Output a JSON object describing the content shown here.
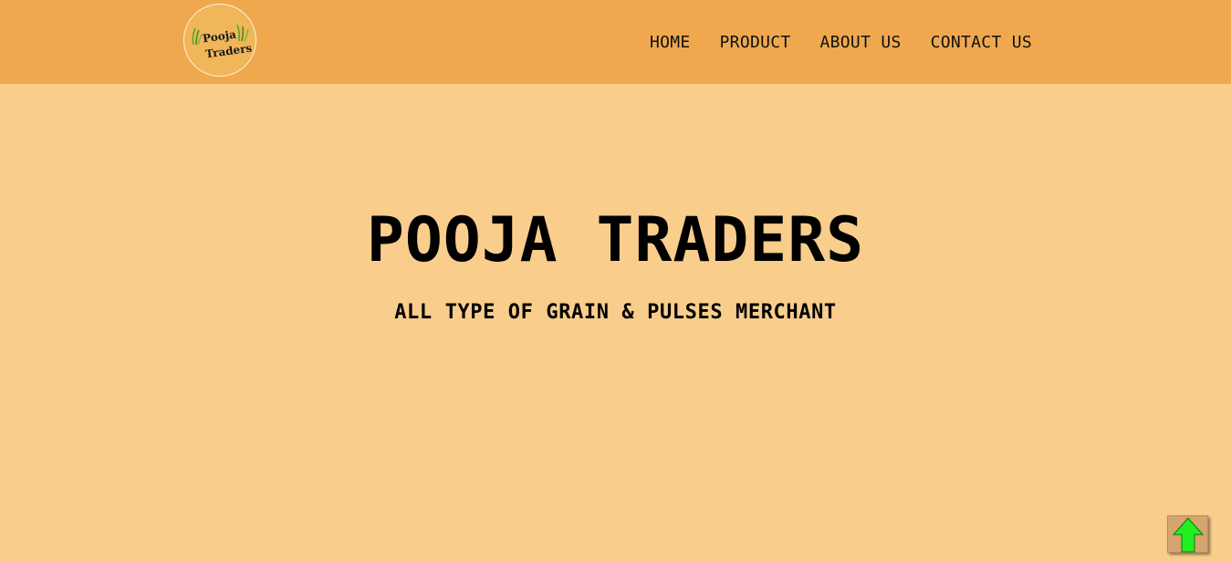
{
  "logo": {
    "line1": "Pooja",
    "line2": "Traders",
    "icon": "grain-stalks-icon"
  },
  "nav": {
    "items": [
      {
        "label": "HOME"
      },
      {
        "label": "PRODUCT"
      },
      {
        "label": "ABOUT US"
      },
      {
        "label": "CONTACT US"
      }
    ]
  },
  "hero": {
    "title": "POOJA TRADERS",
    "subtitle": "ALL TYPE OF GRAIN & PULSES MERCHANT"
  },
  "scroll_top": {
    "icon": "arrow-up-icon",
    "color": "#22ee22"
  },
  "colors": {
    "header": "#f0a84f",
    "background": "#f9cd8b"
  }
}
